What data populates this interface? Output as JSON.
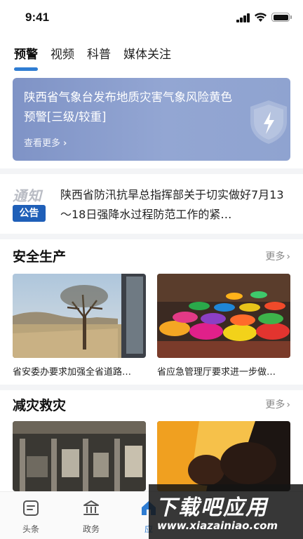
{
  "status_bar": {
    "time": "9:41"
  },
  "tabs": [
    {
      "label": "预警",
      "active": true
    },
    {
      "label": "视频",
      "active": false
    },
    {
      "label": "科普",
      "active": false
    },
    {
      "label": "媒体关注",
      "active": false
    }
  ],
  "warning": {
    "title": "陕西省气象台发布地质灾害气象风险黄色预警[三级/较重]",
    "more": "查看更多"
  },
  "notice": {
    "logo_text": "通知",
    "badge": "公告",
    "text": "陕西省防汛抗旱总指挥部关于切实做好7月13～18日强降水过程防范工作的紧…"
  },
  "sections": [
    {
      "title": "安全生产",
      "more": "更多",
      "items": [
        {
          "caption": "省安委办要求加强全省道路…"
        },
        {
          "caption": "省应急管理厅要求进一步做…"
        }
      ]
    },
    {
      "title": "减灾救灾",
      "more": "更多",
      "items": [
        {
          "caption": ""
        },
        {
          "caption": ""
        }
      ]
    }
  ],
  "bottom_nav": [
    {
      "label": "头条",
      "icon": "news-icon"
    },
    {
      "label": "政务",
      "icon": "government-icon"
    },
    {
      "label": "应",
      "icon": "home-icon"
    }
  ],
  "watermark": {
    "main": "下载吧应用",
    "sub": "www.xiazainiao.com"
  },
  "colors": {
    "accent": "#2f7dd3",
    "badge": "#1f5fb8",
    "banner": "#8a9dcf"
  }
}
